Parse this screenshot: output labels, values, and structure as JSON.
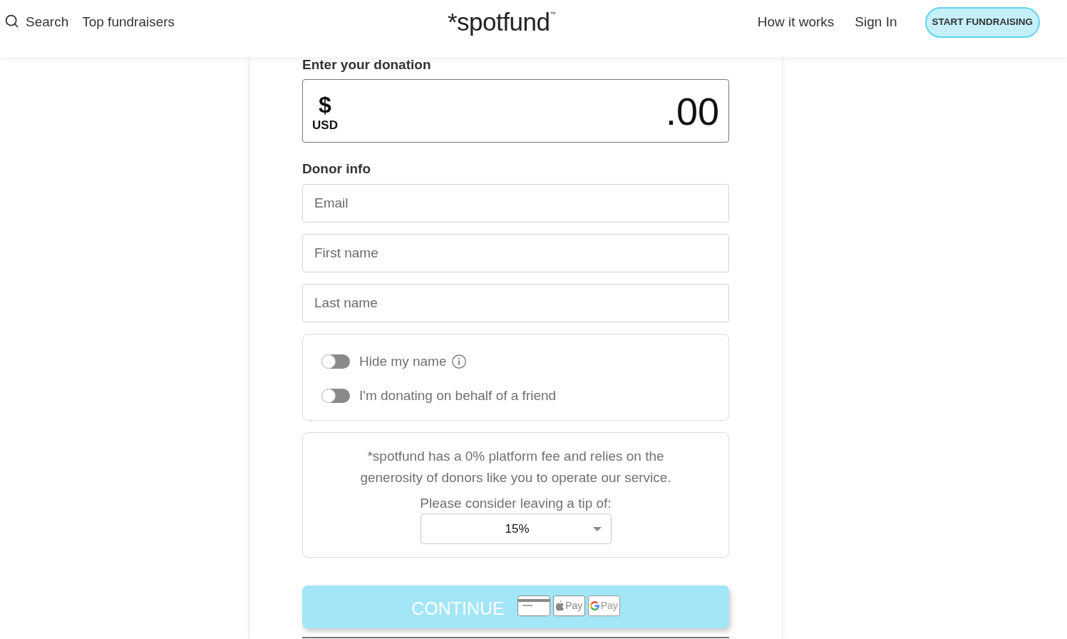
{
  "header": {
    "nav_left": [
      {
        "kind": "search",
        "label": "Search"
      },
      {
        "kind": "link",
        "label": "Top fundraisers"
      }
    ],
    "logo": {
      "text": "*spotfund",
      "mark": "™"
    },
    "nav_right": [
      {
        "label": "How it works"
      },
      {
        "label": "Sign In"
      }
    ],
    "cta_button": "START FUNDRAISING"
  },
  "donation": {
    "heading": "Enter your donation",
    "currency_symbol": "$",
    "currency_code": "USD",
    "amount": ".00"
  },
  "donor_info": {
    "heading": "Donor info",
    "fields": [
      {
        "placeholder": "Email"
      },
      {
        "placeholder": "First name"
      },
      {
        "placeholder": "Last name"
      }
    ]
  },
  "options": [
    {
      "label": "Hide my name",
      "on": false,
      "info": true
    },
    {
      "label": "I'm donating on behalf of a friend",
      "on": false,
      "info": false
    }
  ],
  "tip": {
    "message": "*spotfund has a 0% platform fee and relies on the generosity of donors like you to operate our service.",
    "prompt": "Please consider leaving a tip of:",
    "value": "15%"
  },
  "continue_button": {
    "label": "CONTINUE",
    "payment_methods": [
      {
        "kind": "card"
      },
      {
        "kind": "apple_pay",
        "label": "Pay"
      },
      {
        "kind": "google_pay",
        "label": "Pay"
      }
    ]
  }
}
